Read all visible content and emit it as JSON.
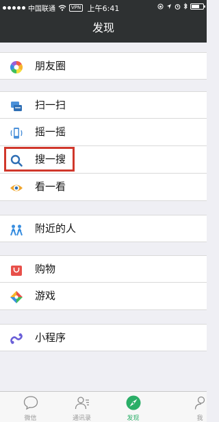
{
  "status": {
    "carrier": "中国联通",
    "vpn": "VPN",
    "time": "上午6:41"
  },
  "nav": {
    "title": "发现"
  },
  "menu": {
    "moments": "朋友圈",
    "scan": "扫一扫",
    "shake": "摇一摇",
    "search": "搜一搜",
    "look": "看一看",
    "nearby": "附近的人",
    "shopping": "购物",
    "games": "游戏",
    "mini_programs": "小程序"
  },
  "tabs": [
    {
      "label": "微信",
      "icon": "chat-bubble-icon"
    },
    {
      "label": "通讯录",
      "icon": "contacts-icon"
    },
    {
      "label": "发现",
      "icon": "compass-icon"
    },
    {
      "label": "我",
      "icon": "person-icon"
    }
  ],
  "colors": {
    "navbar": "#2e3132",
    "highlight_box": "#d0372b",
    "active_tab": "#2aae67"
  }
}
